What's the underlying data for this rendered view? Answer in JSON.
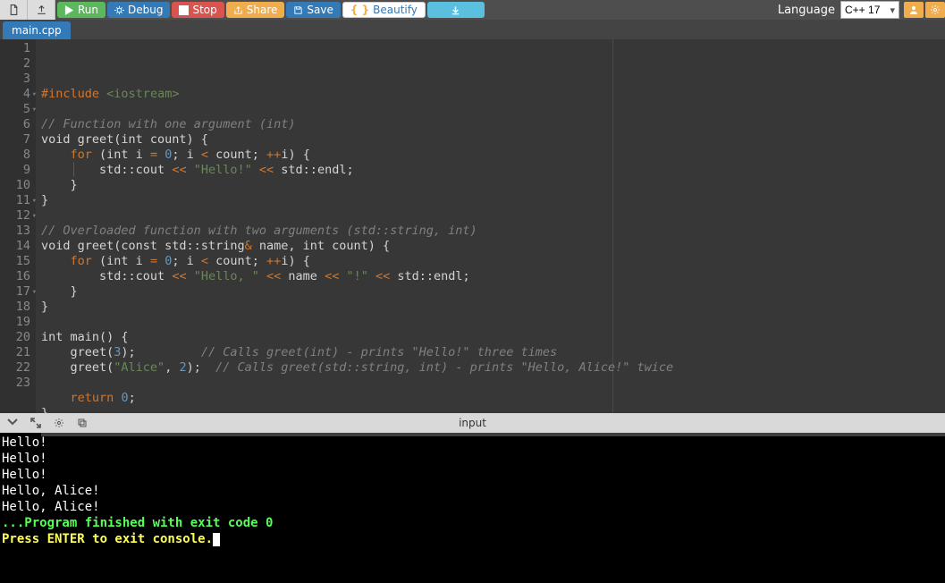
{
  "toolbar": {
    "run": "Run",
    "debug": "Debug",
    "stop": "Stop",
    "share": "Share",
    "save": "Save",
    "beautify": "Beautify",
    "language_label": "Language",
    "language_value": "C++ 17"
  },
  "tabs": {
    "active": "main.cpp"
  },
  "editor": {
    "lines": [
      {
        "n": 1,
        "fold": false,
        "segs": [
          [
            "kw",
            "#include"
          ],
          [
            "pl",
            " "
          ],
          [
            "str",
            "<iostream>"
          ]
        ]
      },
      {
        "n": 2,
        "fold": false,
        "segs": [
          [
            "pl",
            ""
          ]
        ]
      },
      {
        "n": 3,
        "fold": false,
        "segs": [
          [
            "cm",
            "// Function with one argument (int)"
          ]
        ]
      },
      {
        "n": 4,
        "fold": true,
        "segs": [
          [
            "pl",
            "void greet(int count) {"
          ]
        ]
      },
      {
        "n": 5,
        "fold": true,
        "segs": [
          [
            "pl",
            "    "
          ],
          [
            "kw",
            "for"
          ],
          [
            "pl",
            " (int i "
          ],
          [
            "opc",
            "="
          ],
          [
            "pl",
            " "
          ],
          [
            "num",
            "0"
          ],
          [
            "pl",
            "; i "
          ],
          [
            "opc",
            "<"
          ],
          [
            "pl",
            " count; "
          ],
          [
            "opc",
            "++"
          ],
          [
            "pl",
            "i) {"
          ]
        ]
      },
      {
        "n": 6,
        "fold": false,
        "segs": [
          [
            "pl",
            "    "
          ],
          [
            "indent-guide",
            "│"
          ],
          [
            "pl",
            "   std::cout "
          ],
          [
            "opc",
            "<<"
          ],
          [
            "pl",
            " "
          ],
          [
            "str",
            "\"Hello!\""
          ],
          [
            "pl",
            " "
          ],
          [
            "opc",
            "<<"
          ],
          [
            "pl",
            " std::endl;"
          ]
        ]
      },
      {
        "n": 7,
        "fold": false,
        "segs": [
          [
            "pl",
            "    }"
          ]
        ]
      },
      {
        "n": 8,
        "fold": false,
        "segs": [
          [
            "pl",
            "}"
          ]
        ]
      },
      {
        "n": 9,
        "fold": false,
        "segs": [
          [
            "pl",
            ""
          ]
        ]
      },
      {
        "n": 10,
        "fold": false,
        "segs": [
          [
            "cm",
            "// Overloaded function with two arguments (std::string, int)"
          ]
        ]
      },
      {
        "n": 11,
        "fold": true,
        "segs": [
          [
            "pl",
            "void greet(const std::string"
          ],
          [
            "opc",
            "&"
          ],
          [
            "pl",
            " name, int count) {"
          ]
        ]
      },
      {
        "n": 12,
        "fold": true,
        "segs": [
          [
            "pl",
            "    "
          ],
          [
            "kw",
            "for"
          ],
          [
            "pl",
            " (int i "
          ],
          [
            "opc",
            "="
          ],
          [
            "pl",
            " "
          ],
          [
            "num",
            "0"
          ],
          [
            "pl",
            "; i "
          ],
          [
            "opc",
            "<"
          ],
          [
            "pl",
            " count; "
          ],
          [
            "opc",
            "++"
          ],
          [
            "pl",
            "i) {"
          ]
        ]
      },
      {
        "n": 13,
        "fold": false,
        "segs": [
          [
            "pl",
            "        std::cout "
          ],
          [
            "opc",
            "<<"
          ],
          [
            "pl",
            " "
          ],
          [
            "str",
            "\"Hello, \""
          ],
          [
            "pl",
            " "
          ],
          [
            "opc",
            "<<"
          ],
          [
            "pl",
            " name "
          ],
          [
            "opc",
            "<<"
          ],
          [
            "pl",
            " "
          ],
          [
            "str",
            "\"!\""
          ],
          [
            "pl",
            " "
          ],
          [
            "opc",
            "<<"
          ],
          [
            "pl",
            " std::endl;"
          ]
        ]
      },
      {
        "n": 14,
        "fold": false,
        "segs": [
          [
            "pl",
            "    }"
          ]
        ]
      },
      {
        "n": 15,
        "fold": false,
        "segs": [
          [
            "pl",
            "}"
          ]
        ]
      },
      {
        "n": 16,
        "fold": false,
        "segs": [
          [
            "pl",
            ""
          ]
        ]
      },
      {
        "n": 17,
        "fold": true,
        "segs": [
          [
            "pl",
            "int main() {"
          ]
        ]
      },
      {
        "n": 18,
        "fold": false,
        "segs": [
          [
            "pl",
            "    greet("
          ],
          [
            "num",
            "3"
          ],
          [
            "pl",
            ");         "
          ],
          [
            "cm",
            "// Calls greet(int) - prints \"Hello!\" three times"
          ]
        ]
      },
      {
        "n": 19,
        "fold": false,
        "segs": [
          [
            "pl",
            "    greet("
          ],
          [
            "str",
            "\"Alice\""
          ],
          [
            "pl",
            ", "
          ],
          [
            "num",
            "2"
          ],
          [
            "pl",
            ");  "
          ],
          [
            "cm",
            "// Calls greet(std::string, int) - prints \"Hello, Alice!\" twice"
          ]
        ]
      },
      {
        "n": 20,
        "fold": false,
        "segs": [
          [
            "pl",
            ""
          ]
        ]
      },
      {
        "n": 21,
        "fold": false,
        "segs": [
          [
            "pl",
            "    "
          ],
          [
            "kw-return",
            "return"
          ],
          [
            "pl",
            " "
          ],
          [
            "num",
            "0"
          ],
          [
            "pl",
            ";"
          ]
        ]
      },
      {
        "n": 22,
        "fold": false,
        "segs": [
          [
            "pl",
            "}"
          ]
        ]
      },
      {
        "n": 23,
        "fold": false,
        "segs": [
          [
            "pl",
            ""
          ]
        ]
      }
    ]
  },
  "divider": {
    "input_label": "input"
  },
  "terminal": {
    "output": [
      "Hello!",
      "Hello!",
      "Hello!",
      "Hello, Alice!",
      "Hello, Alice!",
      "",
      ""
    ],
    "status": "...Program finished with exit code 0",
    "prompt": "Press ENTER to exit console."
  }
}
